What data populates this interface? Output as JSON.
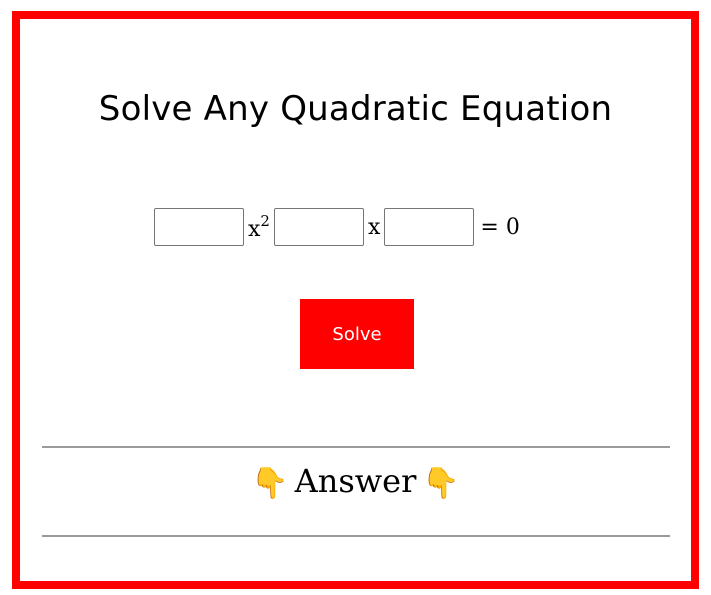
{
  "app": {
    "title": "Solve Any Quadratic Equation"
  },
  "equation": {
    "a_value": "",
    "b_value": "",
    "c_value": "",
    "x_squared_label": "x",
    "exponent_label": "2",
    "x_label": "x",
    "equals_label": "= 0"
  },
  "actions": {
    "solve_label": "Solve"
  },
  "answer": {
    "label": "Answer",
    "left_icon_glyph": "👇",
    "right_icon_glyph": "👇",
    "icon_name": "backhand-index-pointing-down-icon"
  },
  "colors": {
    "accent": "#ff0000",
    "border": "#ff0000",
    "divider": "#9a9a9a"
  }
}
